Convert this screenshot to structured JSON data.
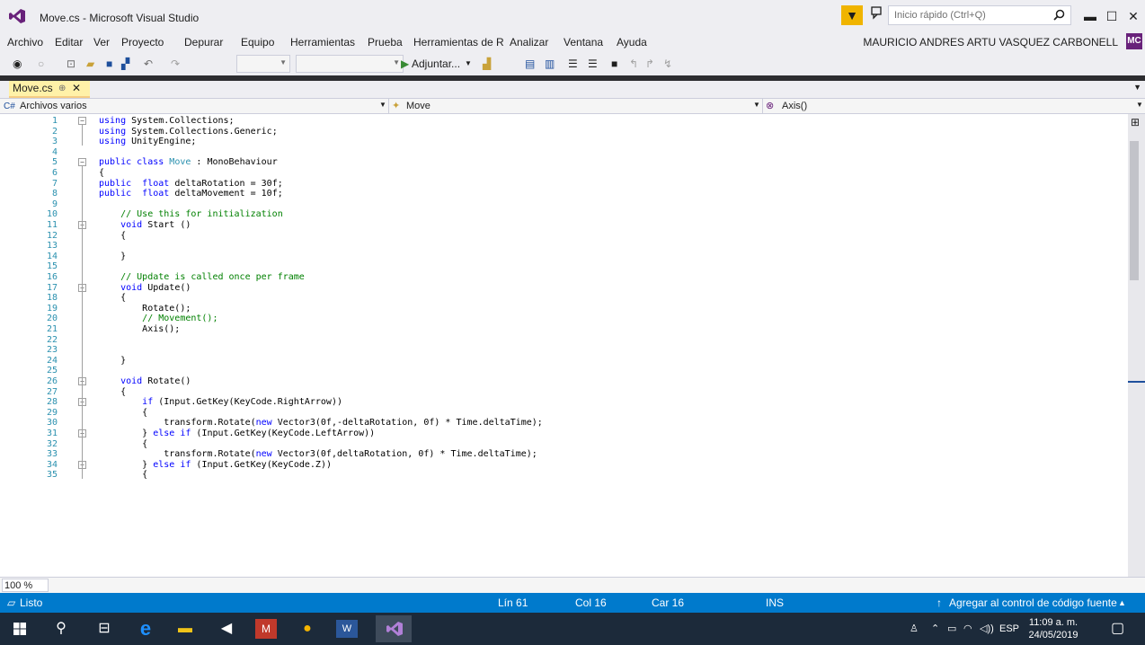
{
  "window": {
    "title": "Move.cs - Microsoft Visual Studio",
    "quick_launch_placeholder": "Inicio rápido (Ctrl+Q)",
    "user": "MAURICIO ANDRES ARTU VASQUEZ CARBONELL",
    "avatar_initials": "MC"
  },
  "menu": [
    "Archivo",
    "Editar",
    "Ver",
    "Proyecto",
    "Depurar",
    "Equipo",
    "Herramientas",
    "Prueba",
    "Herramientas de R",
    "Analizar",
    "Ventana",
    "Ayuda"
  ],
  "toolbar": {
    "attach_label": "Adjuntar..."
  },
  "tab": {
    "label": "Move.cs",
    "pin": "⊕",
    "close": "✕"
  },
  "navbar": {
    "project": "Archivos varios",
    "type": "Move",
    "member": "Axis()"
  },
  "code_lines": [
    {
      "n": "1",
      "t": "using System.Collections;"
    },
    {
      "n": "2",
      "t": "using System.Collections.Generic;"
    },
    {
      "n": "3",
      "t": "using UnityEngine;"
    },
    {
      "n": "4",
      "t": ""
    },
    {
      "n": "5",
      "t": "public class Move : MonoBehaviour"
    },
    {
      "n": "6",
      "t": "{"
    },
    {
      "n": "7",
      "t": "public  float deltaRotation = 30f;"
    },
    {
      "n": "8",
      "t": "public  float deltaMovement = 10f;"
    },
    {
      "n": "9",
      "t": ""
    },
    {
      "n": "10",
      "t": "    // Use this for initialization"
    },
    {
      "n": "11",
      "t": "    void Start ()"
    },
    {
      "n": "12",
      "t": "    {"
    },
    {
      "n": "13",
      "t": ""
    },
    {
      "n": "14",
      "t": "    }"
    },
    {
      "n": "15",
      "t": ""
    },
    {
      "n": "16",
      "t": "    // Update is called once per frame"
    },
    {
      "n": "17",
      "t": "    void Update()"
    },
    {
      "n": "18",
      "t": "    {"
    },
    {
      "n": "19",
      "t": "        Rotate();"
    },
    {
      "n": "20",
      "t": "        // Movement();"
    },
    {
      "n": "21",
      "t": "        Axis();"
    },
    {
      "n": "22",
      "t": ""
    },
    {
      "n": "23",
      "t": ""
    },
    {
      "n": "24",
      "t": "    }"
    },
    {
      "n": "25",
      "t": ""
    },
    {
      "n": "26",
      "t": "    void Rotate()"
    },
    {
      "n": "27",
      "t": "    {"
    },
    {
      "n": "28",
      "t": "        if (Input.GetKey(KeyCode.RightArrow))"
    },
    {
      "n": "29",
      "t": "        {"
    },
    {
      "n": "30",
      "t": "            transform.Rotate(new Vector3(0f,-deltaRotation, 0f) * Time.deltaTime);"
    },
    {
      "n": "31",
      "t": "        } else if (Input.GetKey(KeyCode.LeftArrow))"
    },
    {
      "n": "32",
      "t": "        {"
    },
    {
      "n": "33",
      "t": "            transform.Rotate(new Vector3(0f,deltaRotation, 0f) * Time.deltaTime);"
    },
    {
      "n": "34",
      "t": "        } else if (Input.GetKey(KeyCode.Z))"
    },
    {
      "n": "35",
      "t": "        {"
    }
  ],
  "zoom": "100 %",
  "status": {
    "ready": "Listo",
    "line": "Lín 61",
    "col": "Col 16",
    "car": "Car 16",
    "mode": "INS",
    "source_control": "Agregar al control de código fuente"
  },
  "tray": {
    "lang": "ESP",
    "time": "11:09 a. m.",
    "date": "24/05/2019"
  },
  "colors": {
    "status_bar": "#007acc",
    "keyword": "#0000ff",
    "type": "#2b91af",
    "comment": "#008000",
    "tab_active": "#fff1a8"
  }
}
